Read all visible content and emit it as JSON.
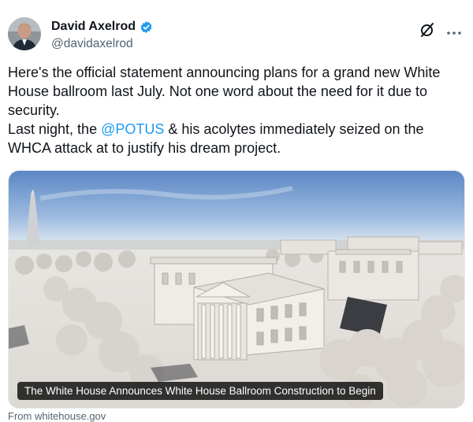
{
  "author": {
    "name": "David Axelrod",
    "handle": "@davidaxelrod",
    "verified": true,
    "verified_color": "#1d9bf0"
  },
  "icons": [
    "avatar",
    "verified-badge-icon",
    "grok-icon",
    "more-icon"
  ],
  "tweet": {
    "line1": "Here's the official statement announcing plans for a grand new White House ballroom last July. Not one word about the need for it due to security.",
    "line2_before": "Last night, the ",
    "mention": "@POTUS",
    "line2_after": " & his acolytes immediately seized on the WHCA attack at to justify his dream project.",
    "mention_color": "#1d9bf0"
  },
  "media": {
    "caption": "The White House Announces White House Ballroom Construction to Begin",
    "source": "From whitehouse.gov"
  }
}
